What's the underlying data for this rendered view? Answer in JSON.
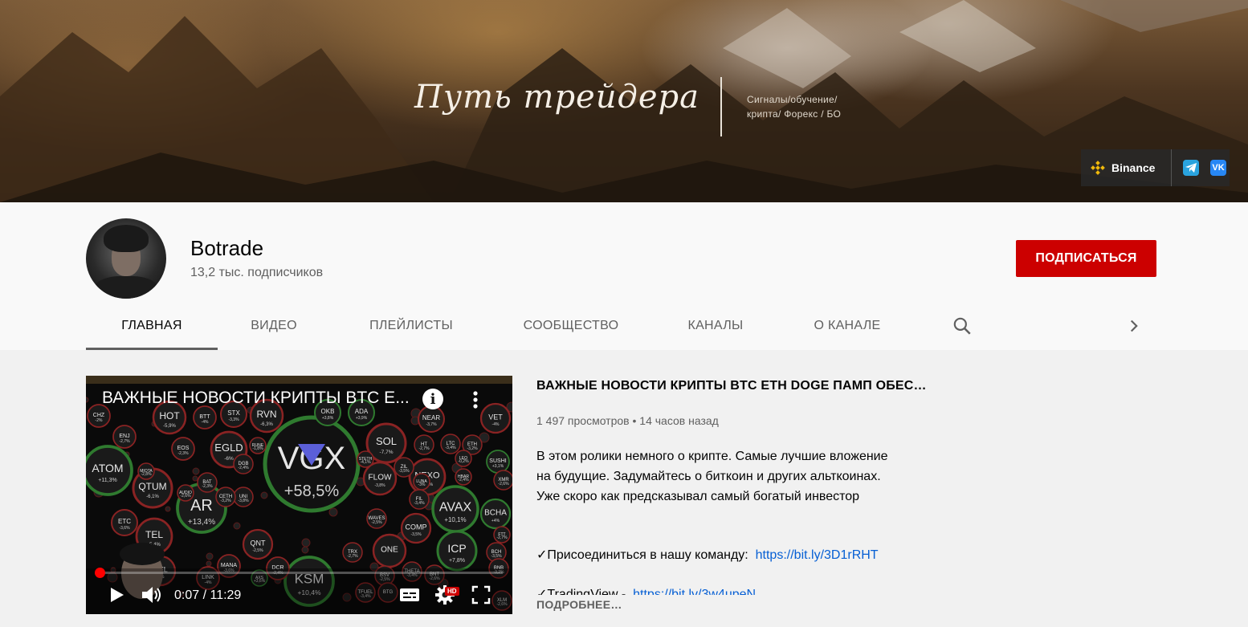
{
  "banner": {
    "title": "Путь трейдера",
    "tagline_line1": "Сигналы/обучение/",
    "tagline_line2": "крипта/ Форекс / БО",
    "links": [
      {
        "label": "Binance",
        "icon": "binance-icon"
      },
      {
        "label": "",
        "icon": "telegram-icon"
      },
      {
        "label": "",
        "icon": "vk-icon"
      }
    ]
  },
  "channel": {
    "name": "Botrade",
    "subscribers": "13,2 тыс. подписчиков",
    "subscribe_label": "ПОДПИСАТЬСЯ"
  },
  "tabs": [
    {
      "label": "ГЛАВНАЯ",
      "active": true
    },
    {
      "label": "ВИДЕО",
      "active": false
    },
    {
      "label": "ПЛЕЙЛИСТЫ",
      "active": false
    },
    {
      "label": "СООБЩЕСТВО",
      "active": false
    },
    {
      "label": "КАНАЛЫ",
      "active": false
    },
    {
      "label": "О КАНАЛЕ",
      "active": false
    }
  ],
  "player": {
    "title": "ВАЖНЫЕ НОВОСТИ КРИПТЫ BTC E...",
    "time": "0:07 / 11:29",
    "progress": 0.0102,
    "hd": "HD",
    "bubbles": [
      {
        "sym": "VGX",
        "val": "+58,5%"
      },
      {
        "sym": "ATOM",
        "val": "+11,3%"
      },
      {
        "sym": "AR",
        "val": "+13,4%"
      },
      {
        "sym": "KSM",
        "val": "+10,4%"
      },
      {
        "sym": "AVAX",
        "val": "+10,1%"
      },
      {
        "sym": "ICP",
        "val": "+7,8%"
      },
      {
        "sym": "EGLD",
        "val": "-6%"
      },
      {
        "sym": "SOL",
        "val": "-7,7%"
      },
      {
        "sym": "QTUM",
        "val": "-6,1%"
      },
      {
        "sym": "HOT",
        "val": "-5,9%"
      },
      {
        "sym": "RVN",
        "val": "-6,3%"
      },
      {
        "sym": "NEXO",
        "val": "-4,7%"
      },
      {
        "sym": "FLOW",
        "val": "-3,8%"
      },
      {
        "sym": "TEL",
        "val": "-5,4%"
      },
      {
        "sym": "BCHA",
        "val": "+4%"
      },
      {
        "sym": "ONE",
        "val": ""
      },
      {
        "sym": "COMP",
        "val": "-3,5%"
      },
      {
        "sym": "QNT",
        "val": "-2,5%"
      },
      {
        "sym": "CEL",
        "val": "-5%"
      },
      {
        "sym": "ETC",
        "val": "-3,6%"
      },
      {
        "sym": "VET",
        "val": "-4%"
      },
      {
        "sym": "NEAR",
        "val": "-3,7%"
      },
      {
        "sym": "ADA",
        "val": "+3,9%"
      },
      {
        "sym": "OKB",
        "val": "+3,8%"
      },
      {
        "sym": "STX",
        "val": "-3,3%"
      },
      {
        "sym": "BTT",
        "val": "-4%"
      },
      {
        "sym": "CHZ",
        "val": "-2%"
      },
      {
        "sym": "ENJ",
        "val": "-2,7%"
      },
      {
        "sym": "EOS",
        "val": "-2,3%"
      },
      {
        "sym": "BAT",
        "val": "-2,3%"
      },
      {
        "sym": "DGB",
        "val": "-2,4%"
      },
      {
        "sym": "UNI",
        "val": "-3,8%"
      },
      {
        "sym": "TRX",
        "val": "-2,7%"
      },
      {
        "sym": "LINK",
        "val": "-4%"
      },
      {
        "sym": "MANA",
        "val": "-3,6%"
      },
      {
        "sym": "DCR",
        "val": "-2,4%"
      },
      {
        "sym": "HT",
        "val": "-2,7%"
      },
      {
        "sym": "LTC",
        "val": "-3,4%"
      },
      {
        "sym": "ETH",
        "val": "-3,2%"
      },
      {
        "sym": "ZIL",
        "val": "-3,5%"
      },
      {
        "sym": "SUSHI",
        "val": "+3,1%"
      },
      {
        "sym": "BCH",
        "val": "-3,5%"
      },
      {
        "sym": "FTT",
        "val": "-2,7%"
      },
      {
        "sym": "BNB",
        "val": "-3,2%"
      },
      {
        "sym": "XLM",
        "val": "-2,6%"
      },
      {
        "sym": "BSV",
        "val": "-2,5%"
      },
      {
        "sym": "BNT",
        "val": "-2,6%"
      },
      {
        "sym": "THETA",
        "val": "-3,4%"
      },
      {
        "sym": "BTG",
        "val": ""
      },
      {
        "sym": "TFUEL",
        "val": "-3,4%"
      },
      {
        "sym": "WAVES",
        "val": "-2,5%"
      },
      {
        "sym": "FIL",
        "val": "-3,4%"
      },
      {
        "sym": "LUNA",
        "val": "-3%"
      },
      {
        "sym": "XMR",
        "val": "-2,6%"
      },
      {
        "sym": "HBAR",
        "val": "-2,4%"
      },
      {
        "sym": "LEO",
        "val": "-0,2%"
      },
      {
        "sym": "MIOTA",
        "val": "-2,8%"
      },
      {
        "sym": "RUNE",
        "val": "-1,8%"
      },
      {
        "sym": "CETH",
        "val": "-3,2%"
      },
      {
        "sym": "AUDIO",
        "val": "-2,6%"
      },
      {
        "sym": "AXS",
        "val": "+3,6%"
      },
      {
        "sym": "STETH",
        "val": "-4,1%"
      }
    ]
  },
  "video": {
    "title": "ВАЖНЫЕ НОВОСТИ КРИПТЫ BTC ETH DOGE ПАМП ОБЕС…",
    "meta": "1 497 просмотров • 14 часов назад",
    "desc_line1": "В этом ролики немного о крипте. Самые лучшие вложение",
    "desc_line2": "на будущие. Задумайтесь о биткоин и других альткоинах.",
    "desc_line3": "Уже скоро как предсказывал самый богатый инвестор",
    "join_label": "✓Присоединиться в нашу команду:",
    "join_link": "https://bit.ly/3D1rRHT",
    "tv_label": "✓TradingView -",
    "tv_link": "https://bit.ly/3w4upeN",
    "more_label": "ПОДРОБНЕЕ…"
  }
}
